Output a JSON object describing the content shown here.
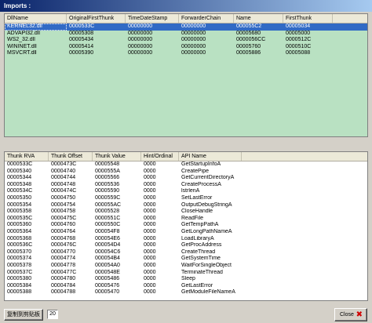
{
  "window": {
    "title": "Imports :"
  },
  "modules": {
    "columns": [
      "DllName",
      "OriginalFirstThunk",
      "TimeDateStamp",
      "ForwarderChain",
      "Name",
      "FirstThunk"
    ],
    "rows": [
      [
        "KERNEL32.dll",
        "0000533C",
        "00000000",
        "00000000",
        "000055C2",
        "00005034"
      ],
      [
        "ADVAPI32.dll",
        "00005308",
        "00000000",
        "00000000",
        "00005680",
        "00005000"
      ],
      [
        "WS2_32.dll",
        "00005434",
        "00000000",
        "00000000",
        "0000056CC",
        "0000512C"
      ],
      [
        "WININET.dll",
        "00005414",
        "00000000",
        "00000000",
        "00005760",
        "0000510C"
      ],
      [
        "MSVCRT.dll",
        "00005390",
        "00000000",
        "00000000",
        "00005886",
        "00005088"
      ]
    ]
  },
  "imports": {
    "columns": [
      "Thunk RVA",
      "Thunk Offset",
      "Thunk Value",
      "Hint/Ordinal",
      "API Name"
    ],
    "rows": [
      [
        "0000533C",
        "0000473C",
        "00005548",
        "0000",
        "GetStartupInfoA"
      ],
      [
        "00005340",
        "00004740",
        "0000555A",
        "0000",
        "CreatePipe"
      ],
      [
        "00005344",
        "00004744",
        "00005566",
        "0000",
        "GetCurrentDirectoryA"
      ],
      [
        "00005348",
        "00004748",
        "00005536",
        "0000",
        "CreateProcessA"
      ],
      [
        "0000534C",
        "0000474C",
        "00005590",
        "0000",
        "lstrlenA"
      ],
      [
        "00005350",
        "00004750",
        "0000559C",
        "0000",
        "SetLastError"
      ],
      [
        "00005354",
        "00004754",
        "000055AC",
        "0000",
        "OutputDebugStringA"
      ],
      [
        "00005358",
        "00004758",
        "00005528",
        "0000",
        "CloseHandle"
      ],
      [
        "0000535C",
        "0000475C",
        "0000551C",
        "0000",
        "ReadFile"
      ],
      [
        "00005360",
        "00004760",
        "0000550C",
        "0000",
        "GetTempPathA"
      ],
      [
        "00005364",
        "00004764",
        "000054F8",
        "0000",
        "GetLongPathNameA"
      ],
      [
        "00005368",
        "00004768",
        "000054E6",
        "0000",
        "LoadLibraryA"
      ],
      [
        "0000536C",
        "0000476C",
        "000054D4",
        "0000",
        "GetProcAddress"
      ],
      [
        "00005370",
        "00004770",
        "000054C6",
        "0000",
        "CreateThread"
      ],
      [
        "00005374",
        "00004774",
        "000054B4",
        "0000",
        "GetSystemTime"
      ],
      [
        "00005378",
        "00004778",
        "000054A0",
        "0000",
        "WaitForSingleObject"
      ],
      [
        "0000537C",
        "0000477C",
        "0000548E",
        "0000",
        "TerminateThread"
      ],
      [
        "00005380",
        "00004780",
        "00005486",
        "0000",
        "Sleep"
      ],
      [
        "00005384",
        "00004784",
        "00005476",
        "0000",
        "GetLastError"
      ],
      [
        "00005388",
        "00004788",
        "00005470",
        "0000",
        "GetModuleFileNameA"
      ]
    ]
  },
  "footer": {
    "copy_label": "复制到剪贴板",
    "count": "20",
    "close_label": "Close",
    "close_icon": "close-x-icon"
  }
}
